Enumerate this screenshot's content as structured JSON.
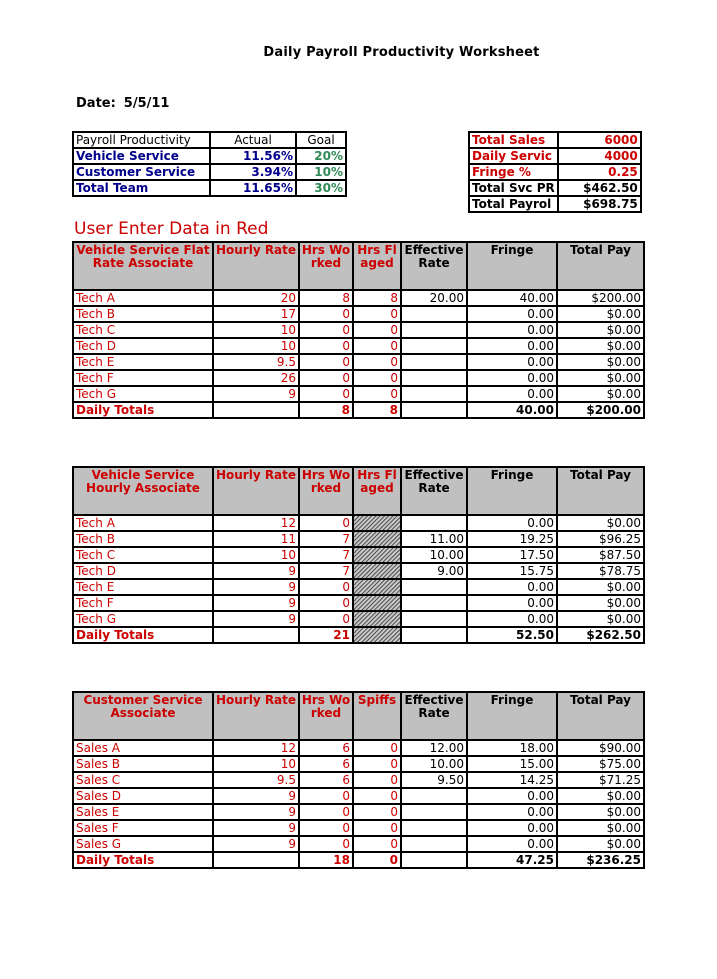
{
  "title": "Daily Payroll Productivity Worksheet",
  "date": {
    "label": "Date:",
    "value": "5/5/11"
  },
  "productivity": {
    "headers": [
      "Payroll Productivity",
      "Actual",
      "Goal"
    ],
    "rows": [
      {
        "label": "Vehicle Service",
        "actual": "11.56%",
        "goal": "20%"
      },
      {
        "label": "Customer Service",
        "actual": "3.94%",
        "goal": "10%"
      },
      {
        "label": "Total Team",
        "actual": "11.65%",
        "goal": "30%"
      }
    ]
  },
  "summary": {
    "rows": [
      {
        "label": "Total Sales",
        "value": "6000",
        "input": true
      },
      {
        "label": "Daily Servic",
        "value": "4000",
        "input": true
      },
      {
        "label": "Fringe %",
        "value": "0.25",
        "input": true
      },
      {
        "label": "Total Svc PR",
        "value": "$462.50",
        "input": false
      },
      {
        "label": "Total Payrol",
        "value": "$698.75",
        "input": false
      }
    ]
  },
  "notice": "User Enter Data in Red",
  "colors": {
    "input": "#cc0000",
    "calc_label": "#00008b",
    "goal": "#2e8b57",
    "header_bg": "#c0c0c0"
  },
  "flat_rate": {
    "headers": [
      "Vehicle Service Flat Rate Associate",
      "Hourly Rate",
      "Hrs Worked",
      "Hrs Flaged",
      "Effective Rate",
      "Fringe",
      "Total Pay"
    ],
    "rows": [
      {
        "name": "Tech A",
        "rate": "20",
        "worked": "8",
        "flagged": "8",
        "eff": "20.00",
        "fringe": "40.00",
        "pay": "$200.00"
      },
      {
        "name": "Tech B",
        "rate": "17",
        "worked": "0",
        "flagged": "0",
        "eff": "",
        "fringe": "0.00",
        "pay": "$0.00"
      },
      {
        "name": "Tech C",
        "rate": "10",
        "worked": "0",
        "flagged": "0",
        "eff": "",
        "fringe": "0.00",
        "pay": "$0.00"
      },
      {
        "name": "Tech D",
        "rate": "10",
        "worked": "0",
        "flagged": "0",
        "eff": "",
        "fringe": "0.00",
        "pay": "$0.00"
      },
      {
        "name": "Tech E",
        "rate": "9.5",
        "worked": "0",
        "flagged": "0",
        "eff": "",
        "fringe": "0.00",
        "pay": "$0.00"
      },
      {
        "name": "Tech F",
        "rate": "26",
        "worked": "0",
        "flagged": "0",
        "eff": "",
        "fringe": "0.00",
        "pay": "$0.00"
      },
      {
        "name": "Tech G",
        "rate": "9",
        "worked": "0",
        "flagged": "0",
        "eff": "",
        "fringe": "0.00",
        "pay": "$0.00"
      }
    ],
    "totals": {
      "label": "Daily Totals",
      "worked": "8",
      "flagged": "8",
      "fringe": "40.00",
      "pay": "$200.00"
    }
  },
  "hourly": {
    "headers": [
      "Vehicle Service Hourly Associate",
      "Hourly Rate",
      "Hrs Worked",
      "Hrs Flaged",
      "Effective Rate",
      "Fringe",
      "Total Pay"
    ],
    "rows": [
      {
        "name": "Tech A",
        "rate": "12",
        "worked": "0",
        "eff": "",
        "fringe": "0.00",
        "pay": "$0.00"
      },
      {
        "name": "Tech B",
        "rate": "11",
        "worked": "7",
        "eff": "11.00",
        "fringe": "19.25",
        "pay": "$96.25"
      },
      {
        "name": "Tech C",
        "rate": "10",
        "worked": "7",
        "eff": "10.00",
        "fringe": "17.50",
        "pay": "$87.50"
      },
      {
        "name": "Tech D",
        "rate": "9",
        "worked": "7",
        "eff": "9.00",
        "fringe": "15.75",
        "pay": "$78.75"
      },
      {
        "name": "Tech E",
        "rate": "9",
        "worked": "0",
        "eff": "",
        "fringe": "0.00",
        "pay": "$0.00"
      },
      {
        "name": "Tech F",
        "rate": "9",
        "worked": "0",
        "eff": "",
        "fringe": "0.00",
        "pay": "$0.00"
      },
      {
        "name": "Tech G",
        "rate": "9",
        "worked": "0",
        "eff": "",
        "fringe": "0.00",
        "pay": "$0.00"
      }
    ],
    "totals": {
      "label": "Daily Totals",
      "worked": "21",
      "fringe": "52.50",
      "pay": "$262.50"
    }
  },
  "customer": {
    "headers": [
      "Customer Service Associate",
      "Hourly Rate",
      "Hrs Worked",
      "Spiffs",
      "Effective Rate",
      "Fringe",
      "Total Pay"
    ],
    "rows": [
      {
        "name": "Sales A",
        "rate": "12",
        "worked": "6",
        "spiffs": "0",
        "eff": "12.00",
        "fringe": "18.00",
        "pay": "$90.00"
      },
      {
        "name": "Sales B",
        "rate": "10",
        "worked": "6",
        "spiffs": "0",
        "eff": "10.00",
        "fringe": "15.00",
        "pay": "$75.00"
      },
      {
        "name": "Sales C",
        "rate": "9.5",
        "worked": "6",
        "spiffs": "0",
        "eff": "9.50",
        "fringe": "14.25",
        "pay": "$71.25"
      },
      {
        "name": "Sales D",
        "rate": "9",
        "worked": "0",
        "spiffs": "0",
        "eff": "",
        "fringe": "0.00",
        "pay": "$0.00"
      },
      {
        "name": "Sales E",
        "rate": "9",
        "worked": "0",
        "spiffs": "0",
        "eff": "",
        "fringe": "0.00",
        "pay": "$0.00"
      },
      {
        "name": "Sales F",
        "rate": "9",
        "worked": "0",
        "spiffs": "0",
        "eff": "",
        "fringe": "0.00",
        "pay": "$0.00"
      },
      {
        "name": "Sales G",
        "rate": "9",
        "worked": "0",
        "spiffs": "0",
        "eff": "",
        "fringe": "0.00",
        "pay": "$0.00"
      }
    ],
    "totals": {
      "label": "Daily Totals",
      "worked": "18",
      "spiffs": "0",
      "fringe": "47.25",
      "pay": "$236.25"
    }
  }
}
